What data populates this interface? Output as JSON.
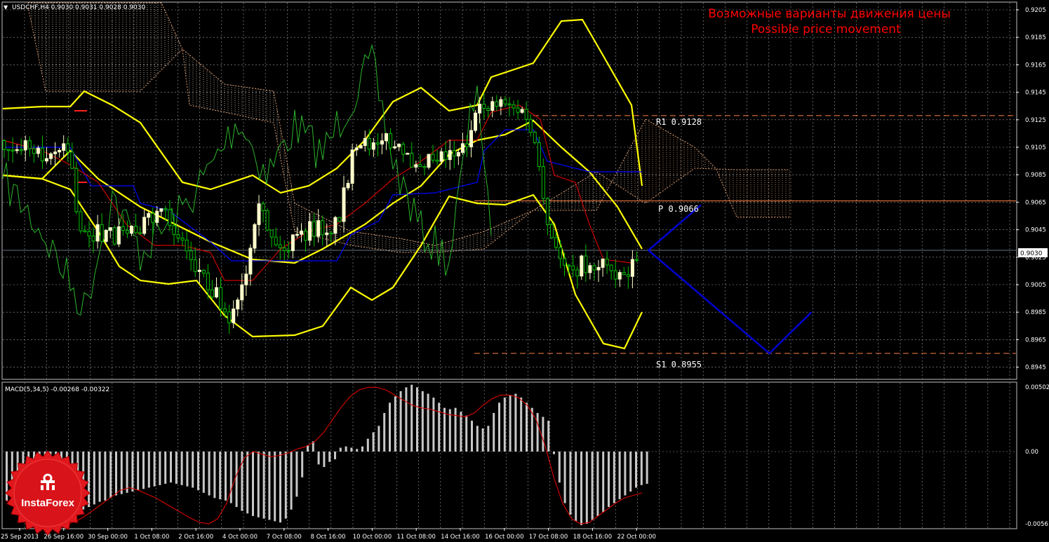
{
  "header": {
    "symbol_info": "USDCHF,H4  0.9030 0.9031 0.9028 0.9030",
    "note_ru": "Возможные варианты движения цены",
    "note_en": "Possible price movement"
  },
  "macd_header": "MACD(5,34,5) -0.00268 -0.00322",
  "logo_text": "InstaForex",
  "colors": {
    "background": "#000000",
    "grid": "#a0a0a0",
    "bollinger": "#ffff00",
    "candle_bull": "#ffffcc",
    "candle_bear": "#00c000",
    "chikou": "#2bb52b",
    "kijun": "#0000ff",
    "tenkan": "#cc0000",
    "kumo": "#d89a6e",
    "forecast": "#0000cc",
    "pivot_line": "#ff8040",
    "macd_hist": "#c8c8c8",
    "macd_signal": "#dd0000",
    "title_red": "#ff0000"
  },
  "chart_data": [
    {
      "type": "line",
      "panel": "price",
      "y_ticks": [
        "0.9205",
        "0.9185",
        "0.9165",
        "0.9145",
        "0.9125",
        "0.9105",
        "0.9085",
        "0.9065",
        "0.9045",
        "0.9025",
        "0.9005",
        "0.8985",
        "0.8965",
        "0.8945"
      ],
      "ylim": [
        0.8937,
        0.9208
      ],
      "current_price": "0.9030",
      "levels": [
        {
          "name": "R1",
          "label": "R1 0.9128",
          "value": 0.9128
        },
        {
          "name": "P",
          "label": "P 0.9066",
          "value": 0.9066
        },
        {
          "name": "S1",
          "label": "S1 0.8955",
          "value": 0.8955
        }
      ],
      "forecast_paths": [
        {
          "name": "up",
          "points": [
            [
              0,
              0.903
            ],
            [
              1,
              0.9063
            ]
          ]
        },
        {
          "name": "down",
          "points": [
            [
              0,
              0.903
            ],
            [
              2.3,
              0.8955
            ],
            [
              3.1,
              0.8985
            ]
          ]
        }
      ],
      "series": [
        {
          "name": "bb_upper",
          "values": [
            0.9135,
            0.914,
            0.9144,
            0.9134,
            0.9102,
            0.9085,
            0.9087,
            0.9097,
            0.9109,
            0.9123,
            0.9131,
            0.9136,
            0.9141,
            0.9154,
            0.9164,
            0.9172,
            0.9202
          ]
        },
        {
          "name": "bb_middle",
          "values": [
            0.9086,
            0.9112,
            0.909,
            0.907,
            0.9058,
            0.9047,
            0.903,
            0.903,
            0.9052,
            0.9074,
            0.909,
            0.9104,
            0.9112,
            0.91,
            0.907,
            0.904,
            0.9035
          ]
        },
        {
          "name": "bb_lower",
          "values": [
            0.909,
            0.905,
            0.901,
            0.8995,
            0.899,
            0.897,
            0.8975,
            0.9,
            0.8995,
            0.903,
            0.9065,
            0.9072,
            0.907,
            0.906,
            0.9,
            0.8962,
            0.8985
          ]
        },
        {
          "name": "close",
          "values": [
            0.9105,
            0.91,
            0.905,
            0.9045,
            0.904,
            0.9005,
            0.9025,
            0.904,
            0.9052,
            0.911,
            0.909,
            0.911,
            0.9125,
            0.913,
            0.904,
            0.902,
            0.903
          ]
        }
      ]
    },
    {
      "type": "bar",
      "panel": "macd",
      "indicator": "MACD(5,34,5)",
      "y_ticks": [
        "0.00502",
        "0.00",
        "-0.0056"
      ],
      "ylim": [
        -0.0058,
        0.0052
      ],
      "main": -0.00268,
      "signal": -0.00322,
      "histogram": [
        -0.0038,
        -0.004,
        -0.0042,
        -0.0044,
        -0.0046,
        -0.0048,
        -0.005,
        -0.0052,
        -0.0054,
        -0.0056,
        -0.0052,
        -0.005,
        -0.0049,
        -0.0047,
        -0.0045,
        -0.0043,
        -0.0041,
        -0.0039,
        -0.0038,
        -0.0036,
        -0.0034,
        -0.0033,
        -0.0032,
        -0.0031,
        -0.003,
        -0.0029,
        -0.0028,
        -0.0027,
        -0.0026,
        -0.0025,
        -0.0024,
        -0.0025,
        -0.0026,
        -0.0027,
        -0.0028,
        -0.003,
        -0.0032,
        -0.0034,
        -0.0036,
        -0.0037,
        -0.0038,
        -0.004,
        -0.0043,
        -0.0046,
        -0.0048,
        -0.005,
        -0.0051,
        -0.0052,
        -0.0053,
        -0.0054,
        -0.0055,
        -0.0052,
        -0.0045,
        -0.0035,
        -0.002,
        0.0005,
        0.0008,
        -0.001,
        -0.0012,
        -0.0008,
        -0.0006,
        0.0003,
        0.0004,
        0.0003,
        0.0002,
        0.0004,
        0.001,
        0.0015,
        0.002,
        0.003,
        0.0038,
        0.0043,
        0.0047,
        0.005,
        0.0052,
        0.005,
        0.0047,
        0.0045,
        0.0042,
        0.0038,
        0.0034,
        0.0033,
        0.0034,
        0.0031,
        0.0028,
        0.0024,
        0.002,
        0.0018,
        0.002,
        0.003,
        0.0038,
        0.0042,
        0.0044,
        0.0045,
        0.0042,
        0.0038,
        0.0034,
        0.003,
        0.0027,
        0.0024,
        -0.0002,
        -0.0024,
        -0.004,
        -0.0049,
        -0.0054,
        -0.0057,
        -0.0056,
        -0.0053,
        -0.005,
        -0.0047,
        -0.0043,
        -0.004,
        -0.0037,
        -0.0034,
        -0.0031,
        -0.0028,
        -0.0026,
        -0.0025
      ],
      "signal_values": [
        -0.0038,
        -0.004,
        -0.0042,
        -0.0044,
        -0.0048,
        -0.0052,
        -0.0055,
        -0.0056,
        -0.0054,
        -0.005,
        -0.0045,
        -0.004,
        -0.0035,
        -0.003,
        -0.0028,
        -0.003,
        -0.0033,
        -0.0036,
        -0.004,
        -0.0044,
        -0.0048,
        -0.0052,
        -0.0055,
        -0.0056,
        -0.0052,
        -0.004,
        -0.002,
        -0.0005,
        0.0,
        -0.0002,
        -0.0004,
        -0.0003,
        -0.0001,
        0.0002,
        0.0004,
        0.0008,
        0.0015,
        0.0025,
        0.0035,
        0.0043,
        0.0048,
        0.005,
        0.005,
        0.0048,
        0.0044,
        0.004,
        0.0036,
        0.0034,
        0.0033,
        0.0031,
        0.0029,
        0.0028,
        0.0027,
        0.003,
        0.0036,
        0.0041,
        0.0044,
        0.0044,
        0.0042,
        0.0036,
        0.0025,
        0.0005,
        -0.002,
        -0.004,
        -0.0052,
        -0.0056,
        -0.0055,
        -0.005,
        -0.0045,
        -0.004,
        -0.0036,
        -0.0034,
        -0.0032
      ]
    }
  ],
  "x_ticks": [
    "25 Sep 2013",
    "26 Sep 16:00",
    "30 Sep 00:00",
    "1 Oct 08:00",
    "2 Oct 16:00",
    "4 Oct 00:00",
    "7 Oct 08:00",
    "8 Oct 16:00",
    "10 Oct 00:00",
    "11 Oct 08:00",
    "14 Oct 16:00",
    "16 Oct 00:00",
    "17 Oct 08:00",
    "18 Oct 16:00",
    "22 Oct 00:00"
  ]
}
